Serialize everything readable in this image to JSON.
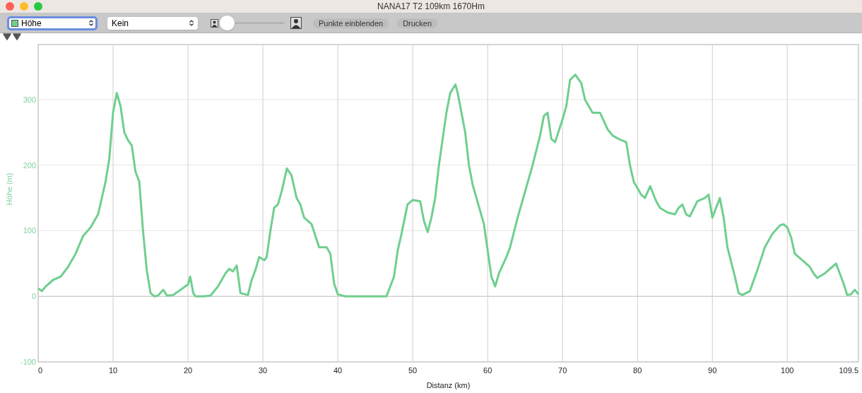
{
  "window": {
    "title": "NANA17 T2 109km 1670Hm"
  },
  "toolbar": {
    "metric_select": {
      "value": "Höhe",
      "color": "#6fcf8f"
    },
    "overlay_select": {
      "value": "Kein"
    },
    "zoom_slider": {
      "level": 0
    },
    "buttons": [
      "Punkte einblenden",
      "Drucken"
    ]
  },
  "chart": {
    "chart_data": {
      "type": "line",
      "xlabel": "Distanz (km)",
      "ylabel": "Höhe (m)",
      "xlim": [
        0,
        109.5
      ],
      "ylim": [
        -100,
        384
      ],
      "xticks": [
        0,
        10,
        20,
        30,
        40,
        50,
        60,
        70,
        80,
        90,
        100,
        109.5
      ],
      "yticks": [
        -100,
        0,
        100,
        200,
        300
      ],
      "x": [
        0,
        0.5,
        1,
        2,
        3,
        4,
        5,
        6,
        7,
        8,
        9,
        9.5,
        10,
        10.5,
        11,
        11.5,
        12,
        12.5,
        13,
        13.5,
        14,
        14.5,
        15,
        15.5,
        16,
        16.7,
        17.2,
        18,
        19,
        20,
        20.3,
        20.7,
        21,
        22,
        23,
        24,
        25,
        25.5,
        26,
        26.5,
        27,
        28,
        28.5,
        29,
        29.5,
        30.2,
        30.5,
        31,
        31.5,
        32,
        32.5,
        33.2,
        33.8,
        34.5,
        35,
        35.5,
        36.5,
        37.5,
        38.5,
        39,
        39.5,
        40,
        41,
        45,
        46.5,
        47,
        47.5,
        48,
        48.5,
        49.3,
        50,
        51,
        51.5,
        52,
        52.5,
        53,
        53.5,
        54,
        54.5,
        55,
        55.7,
        56,
        57,
        57.5,
        58,
        59.5,
        60,
        60.5,
        61,
        61.5,
        62.5,
        63,
        64,
        65,
        66,
        67,
        67.5,
        68,
        68.5,
        69,
        70,
        70.5,
        71,
        71.7,
        72.5,
        73,
        74,
        75,
        76,
        76.7,
        77.5,
        78.5,
        79,
        79.5,
        80.5,
        81,
        81.7,
        82.5,
        83,
        84,
        85,
        85.5,
        86,
        86.5,
        87,
        88,
        89,
        89.5,
        90,
        90.5,
        91,
        91.5,
        92,
        93,
        93.5,
        94,
        95,
        96,
        97,
        98,
        99,
        99.5,
        100,
        100.5,
        101,
        102,
        102.5,
        103,
        103.5,
        104,
        105,
        106,
        106.5,
        107,
        107.5,
        108,
        108.5,
        109,
        109.5
      ],
      "grid": true,
      "series": [
        {
          "color": "#6fcf8f",
          "values": [
            12,
            8,
            15,
            25,
            30,
            45,
            65,
            92,
            105,
            125,
            175,
            210,
            280,
            310,
            290,
            250,
            238,
            230,
            190,
            175,
            100,
            40,
            5,
            0,
            1,
            10,
            1,
            2,
            10,
            18,
            30,
            5,
            0,
            0,
            1,
            15,
            35,
            42,
            38,
            47,
            5,
            2,
            25,
            40,
            60,
            55,
            60,
            100,
            135,
            140,
            160,
            195,
            185,
            150,
            140,
            120,
            110,
            75,
            75,
            65,
            20,
            3,
            0,
            0,
            0,
            15,
            30,
            70,
            95,
            140,
            147,
            145,
            115,
            98,
            120,
            150,
            200,
            240,
            280,
            310,
            323,
            310,
            250,
            200,
            170,
            110,
            70,
            30,
            15,
            35,
            60,
            75,
            120,
            160,
            200,
            245,
            275,
            280,
            240,
            235,
            270,
            290,
            330,
            338,
            325,
            300,
            280,
            280,
            255,
            245,
            240,
            235,
            200,
            175,
            155,
            150,
            168,
            145,
            135,
            128,
            125,
            135,
            140,
            125,
            122,
            145,
            150,
            155,
            120,
            135,
            150,
            120,
            75,
            30,
            5,
            2,
            8,
            40,
            75,
            95,
            108,
            110,
            105,
            90,
            65,
            55,
            50,
            45,
            35,
            28,
            35,
            45,
            50,
            35,
            20,
            2,
            3,
            10,
            3
          ]
        }
      ]
    }
  }
}
